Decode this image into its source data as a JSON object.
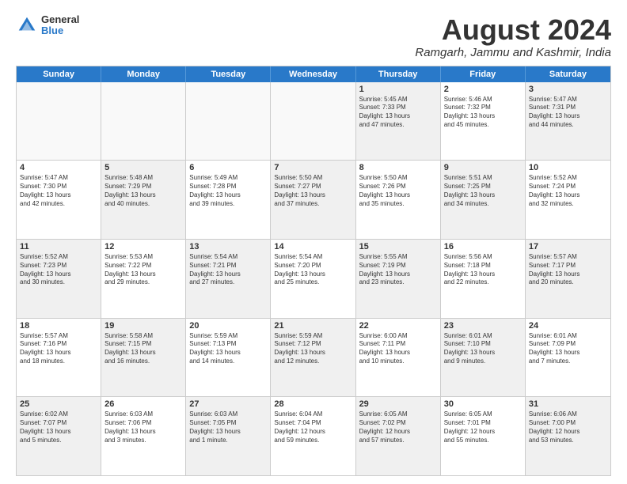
{
  "header": {
    "logo": {
      "general": "General",
      "blue": "Blue"
    },
    "title": "August 2024",
    "location": "Ramgarh, Jammu and Kashmir, India"
  },
  "calendar": {
    "days_of_week": [
      "Sunday",
      "Monday",
      "Tuesday",
      "Wednesday",
      "Thursday",
      "Friday",
      "Saturday"
    ],
    "rows": [
      [
        {
          "day": "",
          "empty": true,
          "lines": []
        },
        {
          "day": "",
          "empty": true,
          "lines": []
        },
        {
          "day": "",
          "empty": true,
          "lines": []
        },
        {
          "day": "",
          "empty": true,
          "lines": []
        },
        {
          "day": "1",
          "shaded": true,
          "lines": [
            "Sunrise: 5:45 AM",
            "Sunset: 7:33 PM",
            "Daylight: 13 hours",
            "and 47 minutes."
          ]
        },
        {
          "day": "2",
          "lines": [
            "Sunrise: 5:46 AM",
            "Sunset: 7:32 PM",
            "Daylight: 13 hours",
            "and 45 minutes."
          ]
        },
        {
          "day": "3",
          "shaded": true,
          "lines": [
            "Sunrise: 5:47 AM",
            "Sunset: 7:31 PM",
            "Daylight: 13 hours",
            "and 44 minutes."
          ]
        }
      ],
      [
        {
          "day": "4",
          "lines": [
            "Sunrise: 5:47 AM",
            "Sunset: 7:30 PM",
            "Daylight: 13 hours",
            "and 42 minutes."
          ]
        },
        {
          "day": "5",
          "shaded": true,
          "lines": [
            "Sunrise: 5:48 AM",
            "Sunset: 7:29 PM",
            "Daylight: 13 hours",
            "and 40 minutes."
          ]
        },
        {
          "day": "6",
          "lines": [
            "Sunrise: 5:49 AM",
            "Sunset: 7:28 PM",
            "Daylight: 13 hours",
            "and 39 minutes."
          ]
        },
        {
          "day": "7",
          "shaded": true,
          "lines": [
            "Sunrise: 5:50 AM",
            "Sunset: 7:27 PM",
            "Daylight: 13 hours",
            "and 37 minutes."
          ]
        },
        {
          "day": "8",
          "lines": [
            "Sunrise: 5:50 AM",
            "Sunset: 7:26 PM",
            "Daylight: 13 hours",
            "and 35 minutes."
          ]
        },
        {
          "day": "9",
          "shaded": true,
          "lines": [
            "Sunrise: 5:51 AM",
            "Sunset: 7:25 PM",
            "Daylight: 13 hours",
            "and 34 minutes."
          ]
        },
        {
          "day": "10",
          "lines": [
            "Sunrise: 5:52 AM",
            "Sunset: 7:24 PM",
            "Daylight: 13 hours",
            "and 32 minutes."
          ]
        }
      ],
      [
        {
          "day": "11",
          "shaded": true,
          "lines": [
            "Sunrise: 5:52 AM",
            "Sunset: 7:23 PM",
            "Daylight: 13 hours",
            "and 30 minutes."
          ]
        },
        {
          "day": "12",
          "lines": [
            "Sunrise: 5:53 AM",
            "Sunset: 7:22 PM",
            "Daylight: 13 hours",
            "and 29 minutes."
          ]
        },
        {
          "day": "13",
          "shaded": true,
          "lines": [
            "Sunrise: 5:54 AM",
            "Sunset: 7:21 PM",
            "Daylight: 13 hours",
            "and 27 minutes."
          ]
        },
        {
          "day": "14",
          "lines": [
            "Sunrise: 5:54 AM",
            "Sunset: 7:20 PM",
            "Daylight: 13 hours",
            "and 25 minutes."
          ]
        },
        {
          "day": "15",
          "shaded": true,
          "lines": [
            "Sunrise: 5:55 AM",
            "Sunset: 7:19 PM",
            "Daylight: 13 hours",
            "and 23 minutes."
          ]
        },
        {
          "day": "16",
          "lines": [
            "Sunrise: 5:56 AM",
            "Sunset: 7:18 PM",
            "Daylight: 13 hours",
            "and 22 minutes."
          ]
        },
        {
          "day": "17",
          "shaded": true,
          "lines": [
            "Sunrise: 5:57 AM",
            "Sunset: 7:17 PM",
            "Daylight: 13 hours",
            "and 20 minutes."
          ]
        }
      ],
      [
        {
          "day": "18",
          "lines": [
            "Sunrise: 5:57 AM",
            "Sunset: 7:16 PM",
            "Daylight: 13 hours",
            "and 18 minutes."
          ]
        },
        {
          "day": "19",
          "shaded": true,
          "lines": [
            "Sunrise: 5:58 AM",
            "Sunset: 7:15 PM",
            "Daylight: 13 hours",
            "and 16 minutes."
          ]
        },
        {
          "day": "20",
          "lines": [
            "Sunrise: 5:59 AM",
            "Sunset: 7:13 PM",
            "Daylight: 13 hours",
            "and 14 minutes."
          ]
        },
        {
          "day": "21",
          "shaded": true,
          "lines": [
            "Sunrise: 5:59 AM",
            "Sunset: 7:12 PM",
            "Daylight: 13 hours",
            "and 12 minutes."
          ]
        },
        {
          "day": "22",
          "lines": [
            "Sunrise: 6:00 AM",
            "Sunset: 7:11 PM",
            "Daylight: 13 hours",
            "and 10 minutes."
          ]
        },
        {
          "day": "23",
          "shaded": true,
          "lines": [
            "Sunrise: 6:01 AM",
            "Sunset: 7:10 PM",
            "Daylight: 13 hours",
            "and 9 minutes."
          ]
        },
        {
          "day": "24",
          "lines": [
            "Sunrise: 6:01 AM",
            "Sunset: 7:09 PM",
            "Daylight: 13 hours",
            "and 7 minutes."
          ]
        }
      ],
      [
        {
          "day": "25",
          "shaded": true,
          "lines": [
            "Sunrise: 6:02 AM",
            "Sunset: 7:07 PM",
            "Daylight: 13 hours",
            "and 5 minutes."
          ]
        },
        {
          "day": "26",
          "lines": [
            "Sunrise: 6:03 AM",
            "Sunset: 7:06 PM",
            "Daylight: 13 hours",
            "and 3 minutes."
          ]
        },
        {
          "day": "27",
          "shaded": true,
          "lines": [
            "Sunrise: 6:03 AM",
            "Sunset: 7:05 PM",
            "Daylight: 13 hours",
            "and 1 minute."
          ]
        },
        {
          "day": "28",
          "lines": [
            "Sunrise: 6:04 AM",
            "Sunset: 7:04 PM",
            "Daylight: 12 hours",
            "and 59 minutes."
          ]
        },
        {
          "day": "29",
          "shaded": true,
          "lines": [
            "Sunrise: 6:05 AM",
            "Sunset: 7:02 PM",
            "Daylight: 12 hours",
            "and 57 minutes."
          ]
        },
        {
          "day": "30",
          "lines": [
            "Sunrise: 6:05 AM",
            "Sunset: 7:01 PM",
            "Daylight: 12 hours",
            "and 55 minutes."
          ]
        },
        {
          "day": "31",
          "shaded": true,
          "lines": [
            "Sunrise: 6:06 AM",
            "Sunset: 7:00 PM",
            "Daylight: 12 hours",
            "and 53 minutes."
          ]
        }
      ]
    ]
  }
}
